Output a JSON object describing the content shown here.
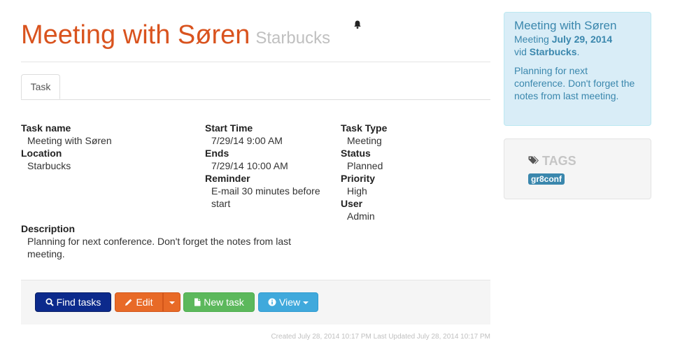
{
  "header": {
    "title": "Meeting with Søren",
    "subtitle": "Starbucks"
  },
  "tabs": [
    {
      "label": "Task"
    }
  ],
  "fields": {
    "task_name": {
      "label": "Task name",
      "value": "Meeting with Søren"
    },
    "location": {
      "label": "Location",
      "value": "Starbucks"
    },
    "start_time": {
      "label": "Start Time",
      "value": "7/29/14 9:00 AM"
    },
    "ends": {
      "label": "Ends",
      "value": "7/29/14 10:00 AM"
    },
    "reminder": {
      "label": "Reminder",
      "value": "E-mail 30 minutes before start"
    },
    "task_type": {
      "label": "Task Type",
      "value": "Meeting"
    },
    "status": {
      "label": "Status",
      "value": "Planned"
    },
    "priority": {
      "label": "Priority",
      "value": "High"
    },
    "user": {
      "label": "User",
      "value": "Admin"
    },
    "description": {
      "label": "Description",
      "value": "Planning for next conference. Don't forget the notes from last meeting."
    }
  },
  "actions": {
    "find": "Find tasks",
    "edit": "Edit",
    "new": "New task",
    "view": "View"
  },
  "footer": {
    "meta": "Created July 28, 2014 10:17 PM Last Updated July 28, 2014 10:17 PM"
  },
  "sidebar": {
    "title": "Meeting with Søren",
    "line1_prefix": "Meeting",
    "line1_date": "July 29, 2014",
    "line2_prefix": "vid",
    "line2_place": "Starbucks",
    "line2_suffix": ".",
    "description": "Planning for next conference. Don't forget the notes from last meeting."
  },
  "tags": {
    "heading": "TAGS",
    "items": [
      "gr8conf"
    ]
  },
  "colors": {
    "title": "#d9531e",
    "primary": "#0c2a8c",
    "edit": "#e86a27",
    "success": "#5cb85c",
    "info": "#40a9dc",
    "alert_bg": "#d9edf7",
    "alert_text": "#3a87ad"
  },
  "icons": [
    "bell-icon",
    "search-icon",
    "pencil-icon",
    "file-icon",
    "info-icon",
    "tags-icon",
    "caret-down-icon"
  ]
}
